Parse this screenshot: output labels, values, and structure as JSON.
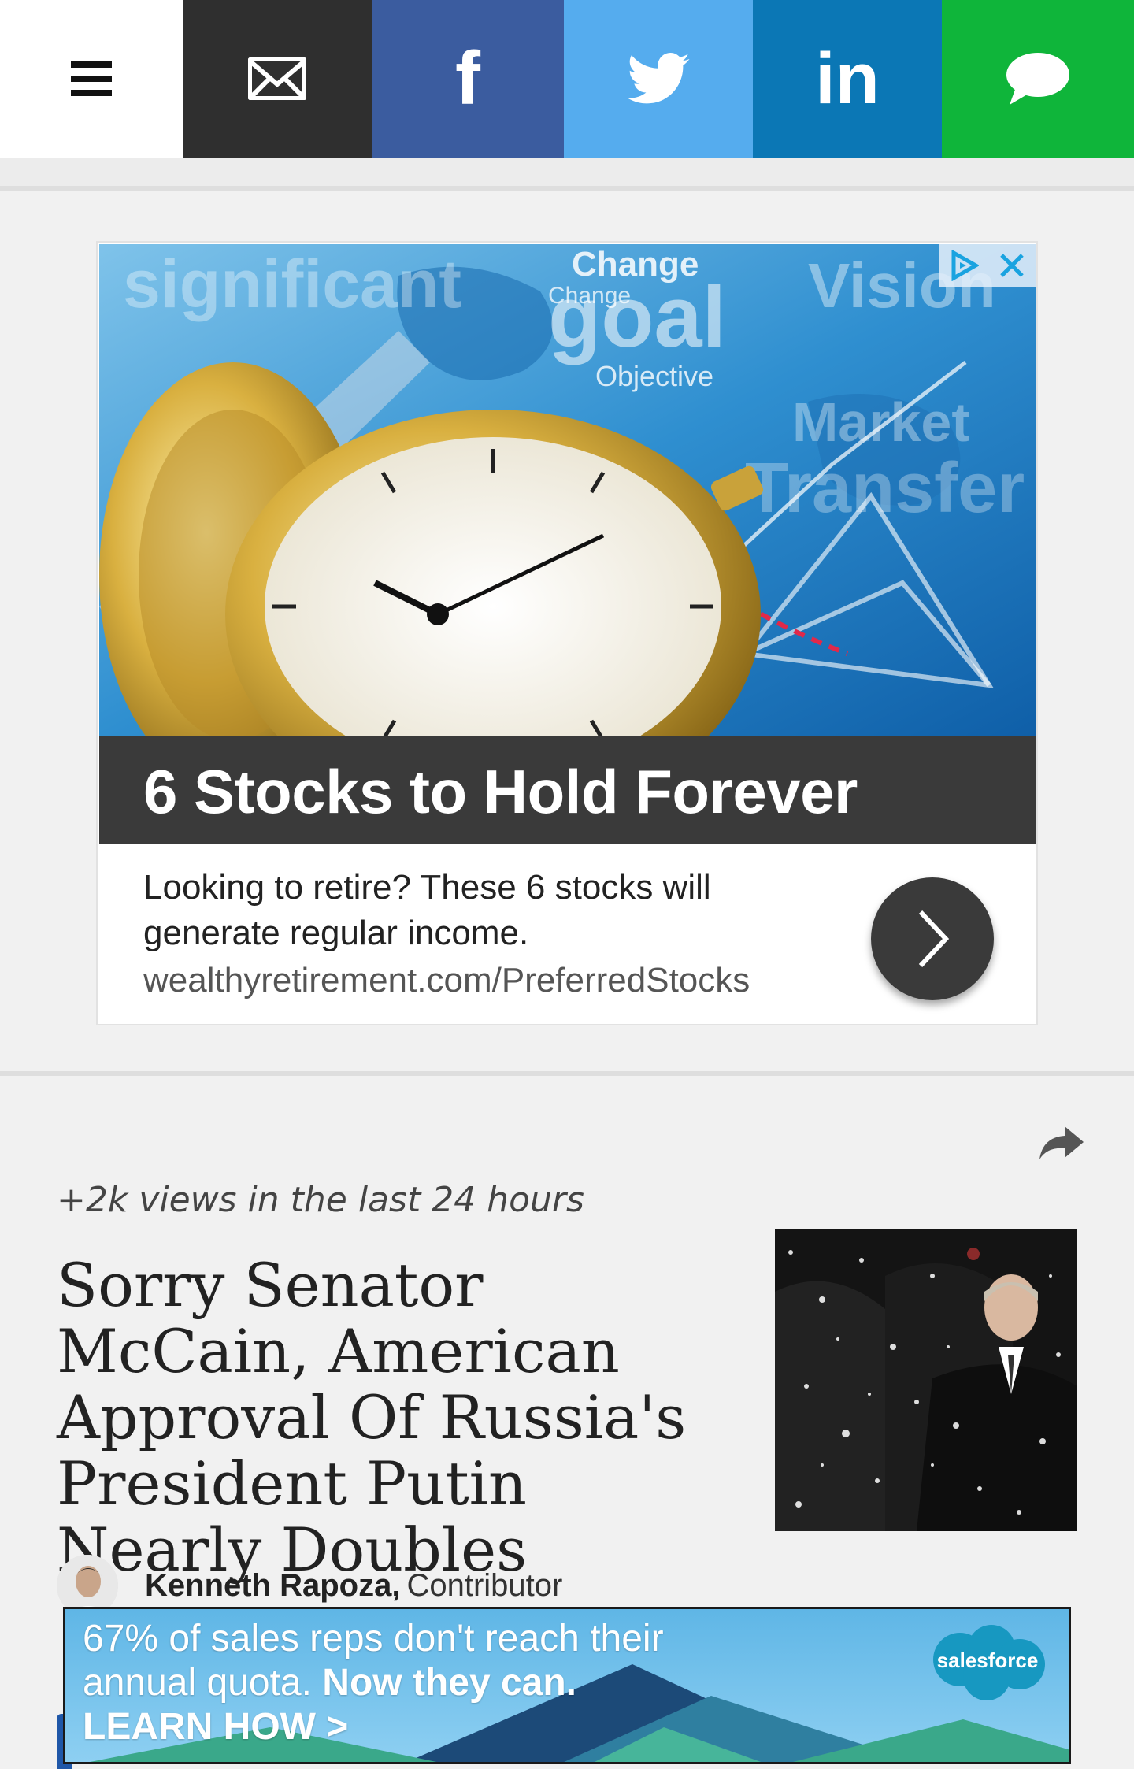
{
  "share_bar": {
    "menu_icon": "hamburger-menu-icon",
    "email_icon": "envelope-icon",
    "facebook_icon": "facebook-icon",
    "twitter_icon": "twitter-bird-icon",
    "linkedin_icon": "linkedin-icon",
    "sms_icon": "speech-bubble-icon",
    "colors": {
      "email": "#2f2f2f",
      "facebook": "#3b5c9f",
      "twitter": "#55acee",
      "linkedin": "#0b77b5",
      "sms": "#0fb53a"
    },
    "linkedin_label": "in",
    "facebook_label": "f"
  },
  "ad": {
    "headline": "6 Stocks to Hold Forever",
    "description": "Looking to retire? These 6 stocks will generate regular income.",
    "url": "wealthyretirement.com/PreferredStocks",
    "image_words": [
      "significant",
      "Change",
      "goal",
      "Objective",
      "Vision",
      "Market",
      "Transfer",
      "Change"
    ],
    "adchoices_icon": "adchoices-icon",
    "close_icon": "close-icon",
    "cta_icon": "chevron-right-icon"
  },
  "article": {
    "views": "+2k views in the last 24 hours",
    "headline": "Sorry Senator McCain, American Approval Of Russia's President Putin Nearly Doubles",
    "author_name": "Kenneth Rapoza,",
    "author_role": "Contributor",
    "share_icon": "share-arrow-icon"
  },
  "banner_ad": {
    "line1": "67% of sales reps don't reach their",
    "line2a": "annual quota.",
    "line2b": "Now they can.",
    "cta": "LEARN HOW >",
    "logo": "salesforce"
  }
}
